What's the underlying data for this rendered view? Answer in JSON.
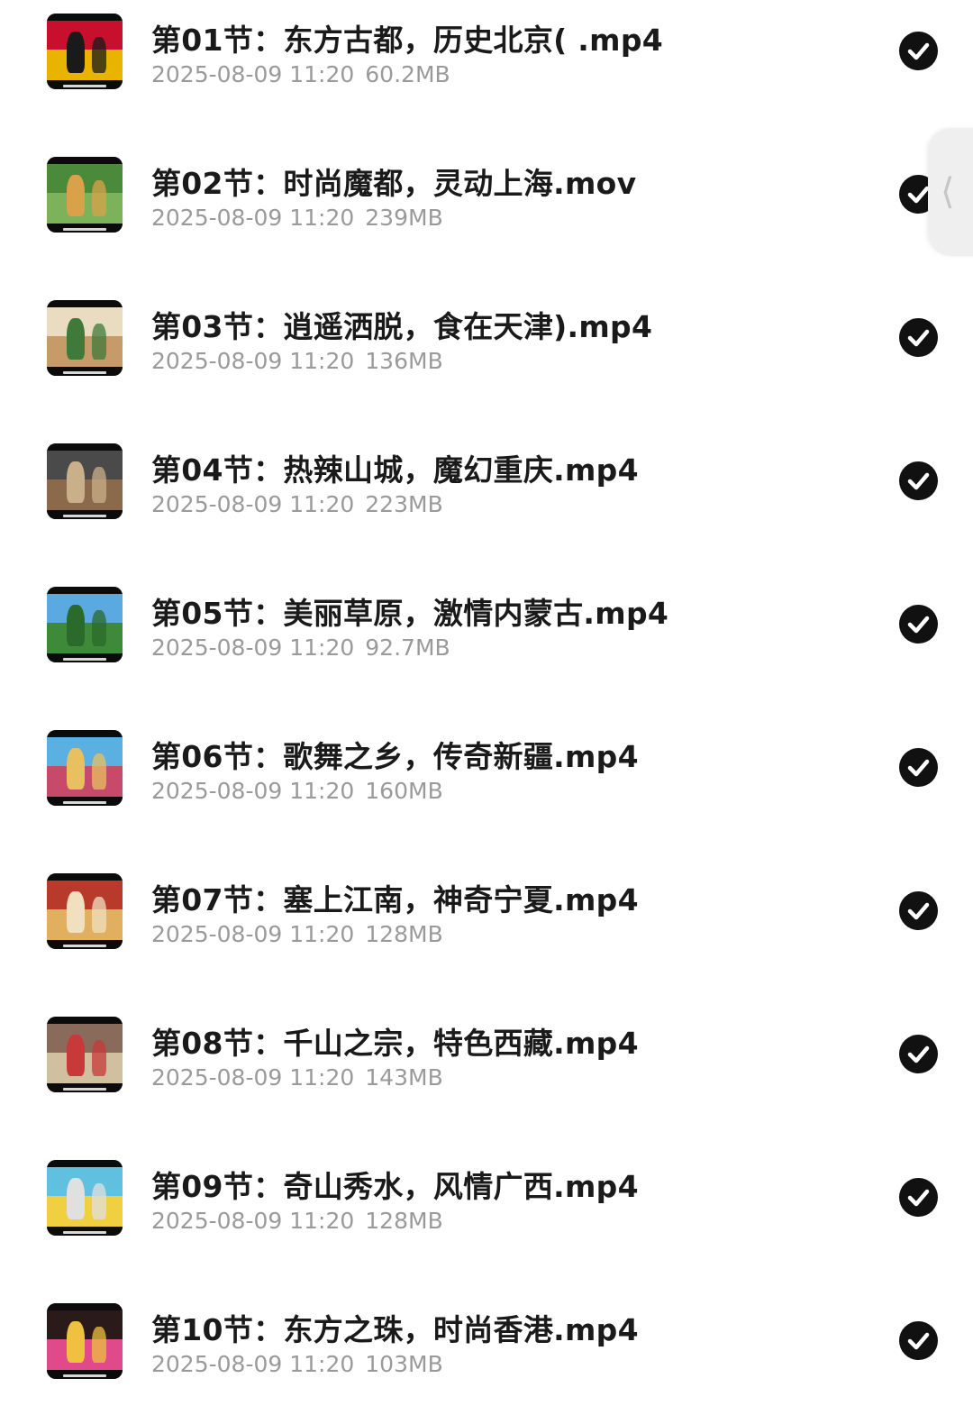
{
  "files": [
    {
      "name": "第01节：东方古都，历史北京( .mp4",
      "date": "2025-08-09 11:20",
      "size": "60.2MB",
      "selected": true,
      "thumb_colors": [
        "#c8102e",
        "#e8b400",
        "#1a1a1a"
      ]
    },
    {
      "name": "第02节：时尚魔都，灵动上海.mov",
      "date": "2025-08-09 11:20",
      "size": "239MB",
      "selected": true,
      "thumb_colors": [
        "#4a8a3a",
        "#7cb35a",
        "#d9a24a"
      ]
    },
    {
      "name": "第03节：逍遥洒脱，食在天津).mp4",
      "date": "2025-08-09 11:20",
      "size": "136MB",
      "selected": true,
      "thumb_colors": [
        "#e9dcc0",
        "#c79a6a",
        "#3f7a3a"
      ]
    },
    {
      "name": "第04节：热辣山城，魔幻重庆.mp4",
      "date": "2025-08-09 11:20",
      "size": "223MB",
      "selected": true,
      "thumb_colors": [
        "#4a4a4a",
        "#8a6a4a",
        "#c9b08a"
      ]
    },
    {
      "name": "第05节：美丽草原，激情内蒙古.mp4",
      "date": "2025-08-09 11:20",
      "size": "92.7MB",
      "selected": true,
      "thumb_colors": [
        "#5aa9e0",
        "#3e8a3a",
        "#2a6a2a"
      ]
    },
    {
      "name": "第06节：歌舞之乡，传奇新疆.mp4",
      "date": "2025-08-09 11:20",
      "size": "160MB",
      "selected": true,
      "thumb_colors": [
        "#5ab0e0",
        "#c84a6a",
        "#e8c060"
      ]
    },
    {
      "name": "第07节：塞上江南，神奇宁夏.mp4",
      "date": "2025-08-09 11:20",
      "size": "128MB",
      "selected": true,
      "thumb_colors": [
        "#b83a2a",
        "#e0b060",
        "#f0e0c0"
      ]
    },
    {
      "name": "第08节：千山之宗，特色西藏.mp4",
      "date": "2025-08-09 11:20",
      "size": "143MB",
      "selected": true,
      "thumb_colors": [
        "#8a6a5a",
        "#d0c0a0",
        "#c83a3a"
      ]
    },
    {
      "name": "第09节：奇山秀水，风情广西.mp4",
      "date": "2025-08-09 11:20",
      "size": "128MB",
      "selected": true,
      "thumb_colors": [
        "#60c0e0",
        "#f0d040",
        "#e0e0e0"
      ]
    },
    {
      "name": "第10节：东方之珠，时尚香港.mp4",
      "date": "2025-08-09 11:20",
      "size": "103MB",
      "selected": true,
      "thumb_colors": [
        "#2a1a1a",
        "#e04a8a",
        "#f0c040"
      ]
    }
  ],
  "icons": {
    "selected_check": "check-circle-icon",
    "side_handle": "chevron-left-icon"
  },
  "side_handle_glyph": "《"
}
